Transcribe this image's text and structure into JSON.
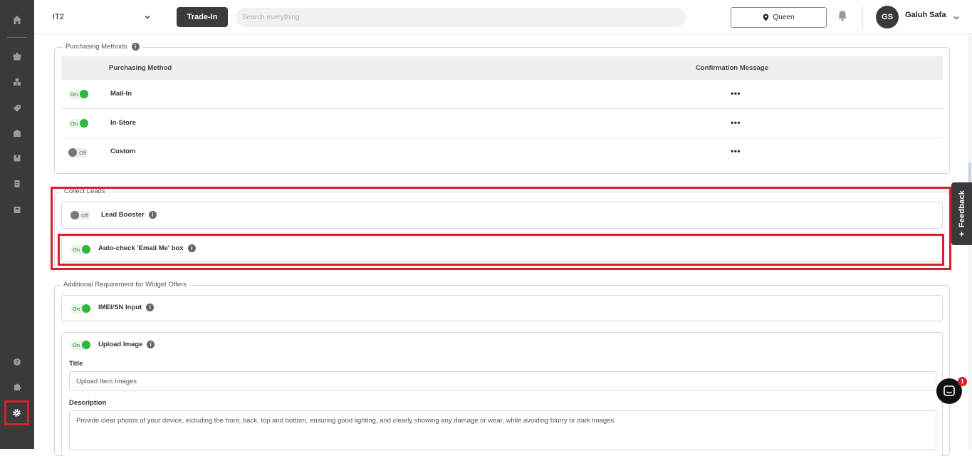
{
  "topbar": {
    "store_value": "IT2",
    "trade_in_label": "Trade-In",
    "search_placeholder": "Search everything",
    "location_label": "Queen",
    "avatar_initials": "GS",
    "user_name": "Galuh Safa"
  },
  "feedback_label": "Feedback",
  "chat_badge_count": "1",
  "purchasing_methods": {
    "legend": "Purchasing Methods",
    "columns": [
      "Purchasing Method",
      "Confirmation Message"
    ],
    "rows": [
      {
        "toggle": "On",
        "state": "on",
        "method": "Mail-In",
        "message": "•••"
      },
      {
        "toggle": "On",
        "state": "on",
        "method": "In-Store",
        "message": "•••"
      },
      {
        "toggle": "Off",
        "state": "off",
        "method": "Custom",
        "message": "•••"
      }
    ]
  },
  "collect_leads": {
    "legend": "Collect Leads",
    "lead_booster": {
      "toggle": "Off",
      "label": "Lead Booster"
    },
    "auto_check": {
      "toggle": "On",
      "label": "Auto-check 'Email Me' box"
    }
  },
  "additional_requirement": {
    "legend": "Additional Requirement for Widget Offers",
    "imei": {
      "toggle": "On",
      "label": "IMEI/SN Input"
    },
    "upload_image": {
      "toggle": "On",
      "label": "Upload Image",
      "title_label": "Title",
      "title_value": "Upload Item Images",
      "description_label": "Description",
      "description_value": "Provide clear photos of your device, including the front, back, top and bottom, ensuring good lighting, and clearly showing any damage or wear, while avoiding blurry or dark images."
    }
  },
  "colors": {
    "sidebar": "#3a3a3a",
    "highlight": "#d7212a",
    "toggle_on": "#2fb83c"
  }
}
